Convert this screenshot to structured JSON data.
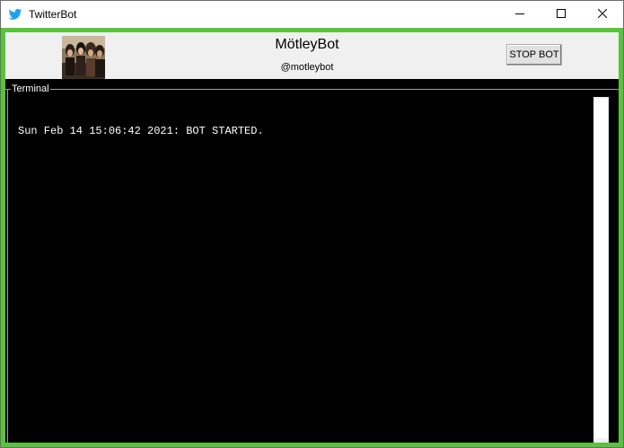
{
  "window": {
    "title": "TwitterBot",
    "icon": "twitter-bird-icon",
    "controls": [
      "minimize-icon",
      "maximize-icon",
      "close-icon"
    ]
  },
  "header": {
    "bot_name": "MötleyBot",
    "bot_handle": "@motleybot",
    "stop_button_label": "STOP BOT"
  },
  "terminal": {
    "label": "Terminal",
    "lines": [
      "Sun Feb 14 15:06:42 2021: BOT STARTED."
    ]
  },
  "colors": {
    "frame_border": "#57c43b",
    "terminal_bg": "#000000",
    "terminal_text": "#ffffff",
    "twitter_blue": "#1da1f2"
  }
}
